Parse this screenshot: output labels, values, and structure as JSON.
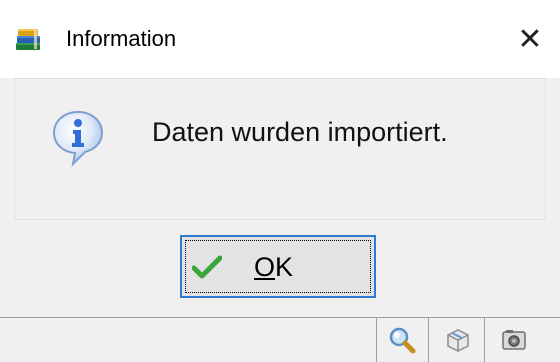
{
  "window": {
    "title": "Information",
    "close_glyph": "✕"
  },
  "dialog": {
    "message": "Daten wurden importiert.",
    "icon": "info-icon"
  },
  "ok_button": {
    "mnemonic": "O",
    "label_rest": "K",
    "icon": "checkmark-icon"
  },
  "statusbar": {
    "buttons": [
      {
        "icon": "magnifier-icon"
      },
      {
        "icon": "box-icon"
      },
      {
        "icon": "camera-icon"
      }
    ]
  },
  "colors": {
    "focus_border": "#2b7bd0",
    "check_green": "#3aa53a",
    "info_blue": "#2f6fd6"
  }
}
